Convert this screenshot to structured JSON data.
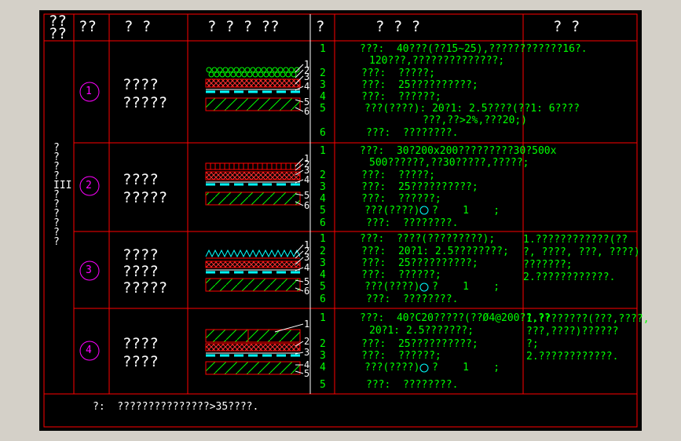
{
  "header": {
    "col1": "??\n??",
    "col2": "??",
    "col3": "? ?",
    "col4": "? ? ? ??",
    "col5": "?",
    "col6": "? ? ?",
    "col7": "? ?"
  },
  "category": "?\n?\n?\n?\nIII\n?\n?\n?\n?\n?\n?",
  "rows": [
    {
      "num": "1",
      "name": "????\n?????",
      "labels": [
        "1",
        "2",
        "3",
        "4",
        "5",
        "6"
      ],
      "idx": [
        "1",
        "2",
        "3",
        "4",
        "5",
        "6"
      ],
      "desc": [
        "???:  40???(??15~25),????????????16?.",
        "120???,??????????????;",
        "???:  ?????;",
        "???:  25??????????;",
        "???:  ??????;",
        "???(????): 20?1: 2.5????(??1: 6????",
        "???,??>2%,???20;)",
        "???:  ????????."
      ],
      "note": ""
    },
    {
      "num": "2",
      "name": "????\n?????",
      "labels": [
        "1",
        "2",
        "3",
        "4",
        "5",
        "6"
      ],
      "idx": [
        "1",
        "2",
        "3",
        "4",
        "5",
        "6"
      ],
      "desc": [
        "???:  30?200x200?????????30?500x",
        "500??????,??30?????,?????;",
        "???:  ?????;",
        "???:  25??????????;",
        "???:  ??????;",
        "???(????)",
        "???:  ????????."
      ],
      "note": ""
    },
    {
      "num": "3",
      "name": "????\n????\n?????",
      "labels": [
        "1",
        "2",
        "3",
        "4",
        "5",
        "6"
      ],
      "idx": [
        "1",
        "2",
        "3",
        "4",
        "5",
        "6"
      ],
      "desc": [
        "???:  ????(?????????);",
        "???:  20?1: 2.5????????;",
        "???:  25??????????;",
        "???:  ??????;",
        "???(????)",
        "???:  ????????."
      ],
      "note": "1.????????????(??\n?, ????, ???, ????)\n???????;\n2.????????????."
    },
    {
      "num": "4",
      "name": "????\n????",
      "labels": [
        "1",
        "2",
        "3",
        "4",
        "5"
      ],
      "idx": [
        "1",
        "2",
        "3",
        "4",
        "5"
      ],
      "desc": [
        "???:  40?C20?????(??Ø4@200??,??",
        "20?1: 2.5???????;",
        "???:  25??????????;",
        "???:  ??????;",
        "???(????)",
        "???:  ????????."
      ],
      "note": "1.????????(???,????,\n???,????)??????\n?;\n2.????????????."
    }
  ],
  "footnote": "?:  ???????????????>35????.",
  "tail_text": "?    1    ;",
  "colors": {
    "frame": "#000000",
    "line": "#ff0000",
    "text": "#ffffff",
    "green": "#00ff00",
    "magenta": "#ff00ff",
    "cyan": "#00ffff",
    "bg": "#d4d0c8"
  }
}
